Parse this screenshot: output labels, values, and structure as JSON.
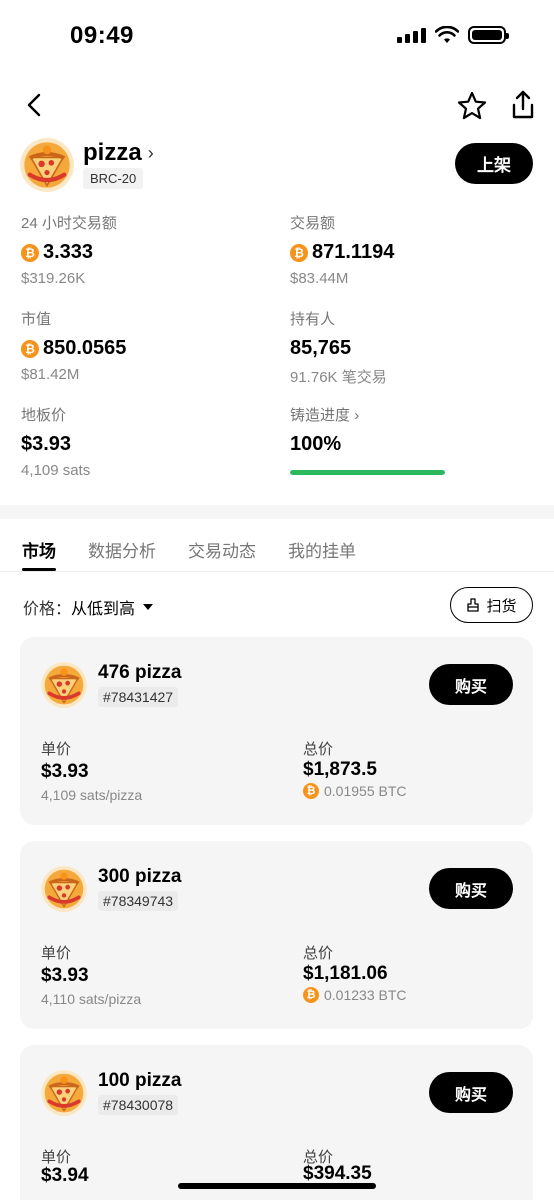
{
  "status_bar": {
    "time": "09:49"
  },
  "token": {
    "name": "pizza",
    "standard": "BRC-20",
    "list_button": "上架"
  },
  "stats": {
    "volume_24h": {
      "label": "24 小时交易额",
      "value": "3.333",
      "sub": "$319.26K"
    },
    "total_volume": {
      "label": "交易额",
      "value": "871.1194",
      "sub": "$83.44M"
    },
    "market_cap": {
      "label": "市值",
      "value": "850.0565",
      "sub": "$81.42M"
    },
    "holders": {
      "label": "持有人",
      "value": "85,765",
      "sub": "91.76K 笔交易"
    },
    "floor_price": {
      "label": "地板价",
      "value": "$3.93",
      "sub": "4,109 sats"
    },
    "mint_progress": {
      "label": "铸造进度",
      "value": "100%",
      "progress": 1.0
    }
  },
  "tabs": [
    {
      "label": "市场",
      "active": true
    },
    {
      "label": "数据分析",
      "active": false
    },
    {
      "label": "交易动态",
      "active": false
    },
    {
      "label": "我的挂单",
      "active": false
    }
  ],
  "sort": {
    "label": "价格：",
    "value": "从低到高",
    "sweep_label": "扫货"
  },
  "listings": [
    {
      "title": "476 pizza",
      "id": "#78431427",
      "buy_label": "购买",
      "unit_label": "单价",
      "unit_price": "$3.93",
      "unit_sats": "4,109 sats/pizza",
      "total_label": "总价",
      "total_price": "$1,873.5",
      "total_btc": "0.01955 BTC"
    },
    {
      "title": "300 pizza",
      "id": "#78349743",
      "buy_label": "购买",
      "unit_label": "单价",
      "unit_price": "$3.93",
      "unit_sats": "4,110 sats/pizza",
      "total_label": "总价",
      "total_price": "$1,181.06",
      "total_btc": "0.01233 BTC"
    },
    {
      "title": "100 pizza",
      "id": "#78430078",
      "buy_label": "购买",
      "unit_label": "单价",
      "unit_price": "$3.94",
      "unit_sats": "",
      "total_label": "总价",
      "total_price": "$394.35",
      "total_btc": ""
    }
  ],
  "colors": {
    "btc": "#f7931a",
    "progress": "#2bb95e",
    "card_bg": "#f5f5f5"
  },
  "icons": {
    "back": "chevron-left-icon",
    "favorite": "star-outline-icon",
    "share": "share-icon",
    "btc": "bitcoin-icon",
    "sweep": "broom-icon"
  }
}
